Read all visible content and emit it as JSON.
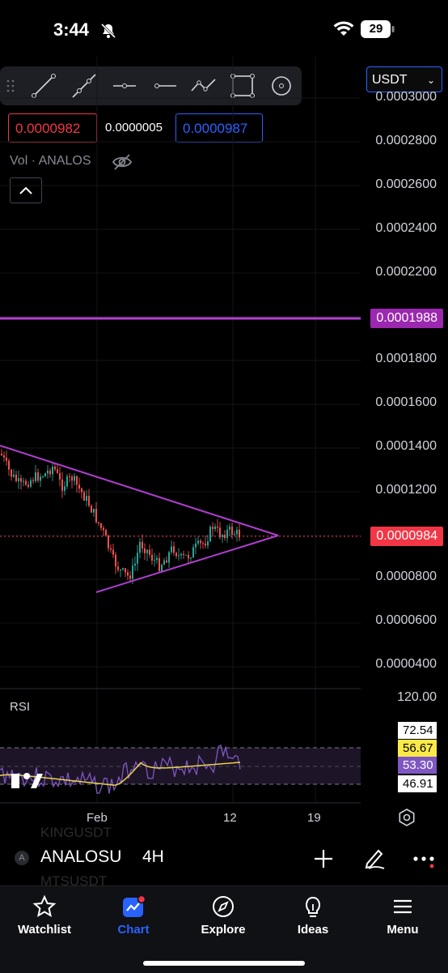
{
  "status_bar": {
    "time": "3:44",
    "battery": "29"
  },
  "toolbar": {
    "tools": [
      "trend-line-icon",
      "ray-icon",
      "horizontal-ray-icon",
      "horizontal-line-icon",
      "path-icon",
      "rectangle-icon",
      "circle-icon"
    ],
    "currency": "USDT"
  },
  "quote": {
    "bid": "0.0000982",
    "spread": "0.0000005",
    "ask": "0.0000987"
  },
  "volume_label": "Vol · ANALOS",
  "price_axis": {
    "labels": [
      "0.0003000",
      "0.0002800",
      "0.0002600",
      "0.0002400",
      "0.0002200",
      "0.0001800",
      "0.0001600",
      "0.0001400",
      "0.0001200",
      "0.0000800",
      "0.0000600",
      "0.0000400"
    ],
    "horizontal_line_tag": "0.0001988",
    "last_price_tag": "0.0000984"
  },
  "rsi": {
    "label": "RSI",
    "top_label": "120.00",
    "tags": [
      "72.54",
      "56.67",
      "53.30",
      "46.91"
    ]
  },
  "time_axis": {
    "labels": [
      "Feb",
      "12",
      "19"
    ]
  },
  "symbol_bar": {
    "avatar": "A",
    "symbol": "ANALOSU",
    "interval": "4H",
    "ghost_above": "KINGUSDT",
    "ghost_below": "MTSUSDT"
  },
  "nav": [
    {
      "label": "Watchlist",
      "icon": "star-icon"
    },
    {
      "label": "Chart",
      "icon": "chart-icon"
    },
    {
      "label": "Explore",
      "icon": "compass-icon"
    },
    {
      "label": "Ideas",
      "icon": "lightbulb-icon"
    },
    {
      "label": "Menu",
      "icon": "hamburger-icon"
    }
  ],
  "colors": {
    "accent": "#2962ff",
    "up": "#26a69a",
    "down": "#ef5350",
    "drawing": "#b03fd0",
    "last_price": "#f23645"
  }
}
